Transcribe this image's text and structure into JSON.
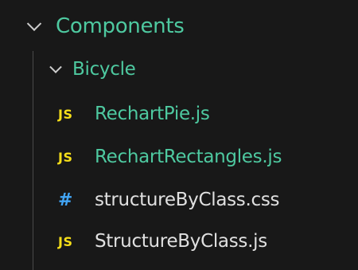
{
  "explorer": {
    "folder": {
      "label": "Components",
      "icon": "chevron-down-icon",
      "expanded": true,
      "label_color": "#4ec9a0"
    },
    "subfolder": {
      "label": "Bicycle",
      "icon": "chevron-down-icon",
      "expanded": true,
      "label_color": "#4ec9a0"
    },
    "files": [
      {
        "icon_text": "JS",
        "icon": "javascript-file-icon",
        "label": "RechartPie.js",
        "modified": true
      },
      {
        "icon_text": "JS",
        "icon": "javascript-file-icon",
        "label": "RechartRectangles.js",
        "modified": true
      },
      {
        "icon_text": "#",
        "icon": "css-file-icon",
        "label": "structureByClass.css",
        "modified": false
      },
      {
        "icon_text": "JS",
        "icon": "javascript-file-icon",
        "label": "StructureByClass.js",
        "modified": false
      }
    ]
  },
  "colors": {
    "background": "#181818",
    "modified_text": "#4ec9a0",
    "plain_text": "#e0e0e0",
    "js_icon": "#f5de19",
    "css_icon": "#42a5f5",
    "chevron": "#cccccc"
  }
}
